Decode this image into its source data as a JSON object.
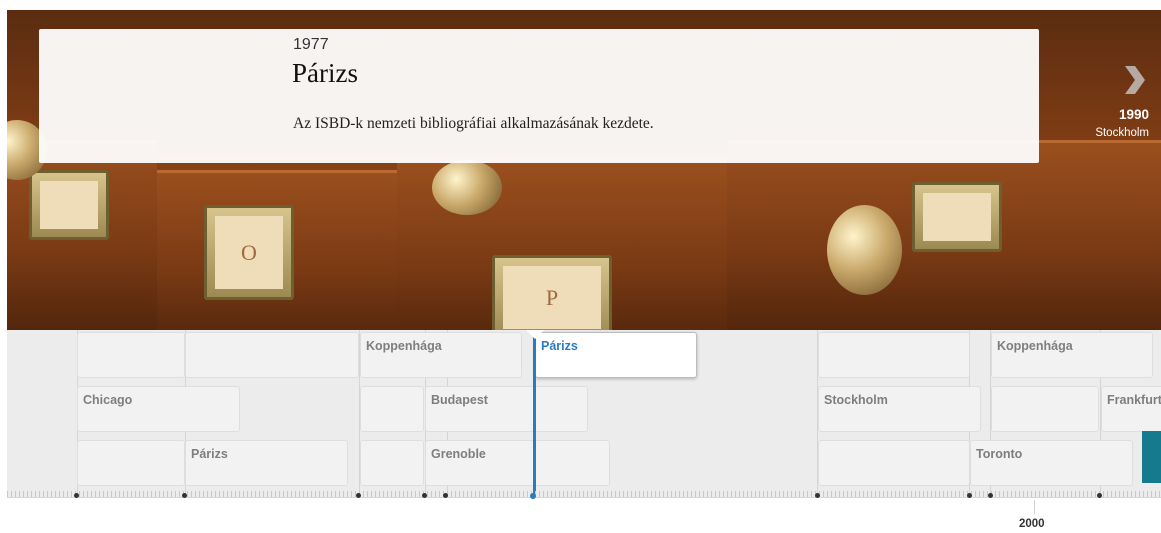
{
  "slide": {
    "year": "1977",
    "title": "Párizs",
    "description": "Az ISBD-k nemzeti bibliográfiai alkalmazásának kezdete."
  },
  "next": {
    "year": "1990",
    "place": "Stockholm"
  },
  "timeline": {
    "markers": {
      "koppenhaga1": "Koppenhága",
      "parizs_active": "Párizs",
      "koppenhaga2": "Koppenhága",
      "chicago": "Chicago",
      "budapest": "Budapest",
      "stockholm": "Stockholm",
      "frankfurt": "Frankfurt",
      "parizs2": "Párizs",
      "grenoble": "Grenoble",
      "toronto": "Toronto"
    },
    "era_label": "2000"
  },
  "hero_plate_letters": [
    "O",
    "P"
  ],
  "colors": {
    "active": "#2a7bbf",
    "side_tab": "#167a8e"
  },
  "icons": {
    "next": "chevron-right-icon"
  }
}
